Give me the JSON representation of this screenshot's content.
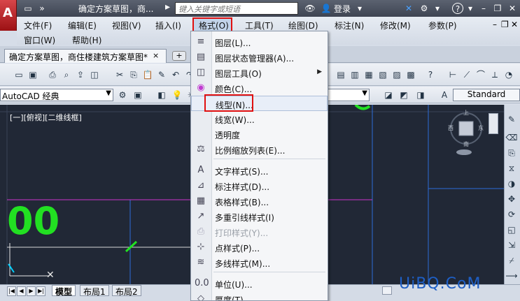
{
  "title_bar": {
    "doc_title": "确定方案草图，商...",
    "search_placeholder": "键入关键字或短语",
    "login_label": "登录"
  },
  "menu_bar": {
    "row1": [
      "文件(F)",
      "编辑(E)",
      "视图(V)",
      "插入(I)",
      "格式(O)",
      "工具(T)",
      "绘图(D)",
      "标注(N)",
      "修改(M)",
      "参数(P)"
    ],
    "row2": [
      "窗口(W)",
      "帮助(H)"
    ],
    "active": "格式(O)"
  },
  "doc_tab": {
    "label": "确定方案草图，商住楼建筑方案草图*",
    "close": "×",
    "add": "+"
  },
  "toolbar2": {
    "workspace": "AutoCAD 经典",
    "text_style": "Standard"
  },
  "viewport": {
    "label": "[一][俯视][二维线框]",
    "compass": {
      "north": "上",
      "east": "东",
      "south": "南",
      "west": "西"
    }
  },
  "layout_tabs": [
    "模型",
    "布局1",
    "布局2"
  ],
  "format_menu": {
    "items": [
      {
        "label": "图层(L)...",
        "icon": "layers-icon"
      },
      {
        "label": "图层状态管理器(A)...",
        "icon": "layer-state-icon"
      },
      {
        "label": "图层工具(O)",
        "icon": "layer-tools-icon",
        "submenu": true
      },
      {
        "label": "颜色(C)...",
        "icon": "color-wheel-icon"
      },
      {
        "label": "线型(N)...",
        "icon": "linetype-icon",
        "highlighted": true
      },
      {
        "label": "线宽(W)...",
        "icon": "lineweight-icon"
      },
      {
        "label": "透明度",
        "icon": "transparency-icon"
      },
      {
        "label": "比例缩放列表(E)...",
        "icon": "scale-list-icon"
      },
      {
        "label": "文字样式(S)...",
        "icon": "text-style-icon"
      },
      {
        "label": "标注样式(D)...",
        "icon": "dim-style-icon"
      },
      {
        "label": "表格样式(B)...",
        "icon": "table-style-icon"
      },
      {
        "label": "多重引线样式(I)",
        "icon": "mleader-style-icon"
      },
      {
        "label": "打印样式(Y)...",
        "icon": "plot-style-icon",
        "disabled": true
      },
      {
        "label": "点样式(P)...",
        "icon": "point-style-icon"
      },
      {
        "label": "多线样式(M)...",
        "icon": "mline-style-icon"
      },
      {
        "label": "单位(U)...",
        "icon": "units-icon"
      },
      {
        "label": "厚度(T)",
        "icon": "thickness-icon"
      }
    ]
  },
  "watermark": "UiBQ.CoM",
  "canvas_text": "00",
  "colors": {
    "canvas_bg": "#212836",
    "highlight_red": "#e01010",
    "drawing_green": "#22e022"
  }
}
